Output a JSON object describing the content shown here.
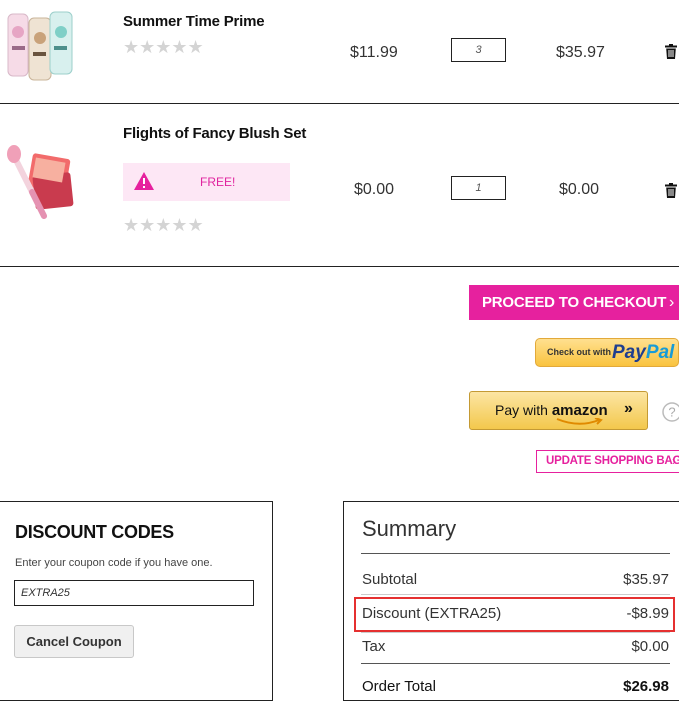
{
  "items": [
    {
      "name": "Summer Time Prime",
      "rating_stars": "★★★★★",
      "price": "$11.99",
      "qty": "3",
      "total": "$35.97",
      "image": "primer-bottles-image"
    },
    {
      "name": "Flights of Fancy Blush Set",
      "rating_stars": "★★★★★",
      "price": "$0.00",
      "qty": "1",
      "total": "$0.00",
      "image": "blush-set-image",
      "badge": {
        "text": "FREE!",
        "icon": "warning-icon",
        "color": "#e0259f"
      }
    }
  ],
  "actions": {
    "checkout_label": "PROCEED TO CHECKOUT",
    "checkout_arrow": "›",
    "paypal_small": "Check out with",
    "paypal_logo_a": "Pay",
    "paypal_logo_b": "Pal",
    "amazon_label_a": "Pay with ",
    "amazon_label_b": "amazon",
    "amazon_chevrons": "»",
    "help_glyph": "?",
    "update_label": "UPDATE SHOPPING BAG",
    "update_arrow": "›"
  },
  "discount": {
    "title": "DISCOUNT CODES",
    "help_text": "Enter your coupon code if you have one.",
    "code": "EXTRA25",
    "cancel_label": "Cancel Coupon"
  },
  "summary": {
    "title": "Summary",
    "rows": [
      {
        "label": "Subtotal",
        "value": "$35.97"
      },
      {
        "label": "Discount (EXTRA25)",
        "value": "-$8.99"
      },
      {
        "label": "Tax",
        "value": "$0.00"
      },
      {
        "label": "Order Total",
        "value": "$26.98"
      }
    ]
  },
  "colors": {
    "brand_pink": "#e6219e",
    "highlight_red": "#e53030",
    "free_badge_bg": "#fde7f5"
  }
}
